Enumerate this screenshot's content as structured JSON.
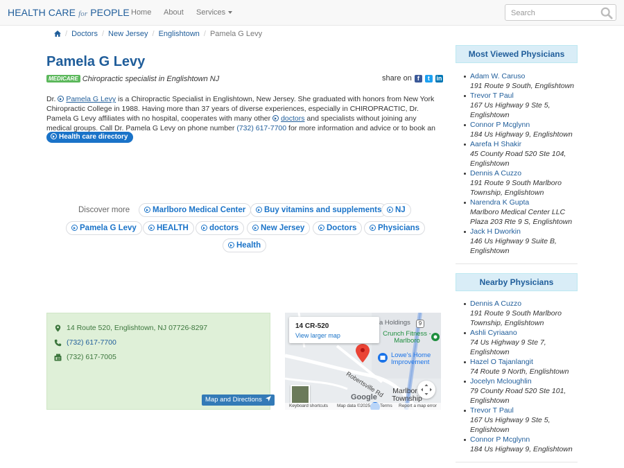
{
  "brand": {
    "health": "HEALTH CARE",
    "for": "for",
    "people": "PEOPLE"
  },
  "nav": {
    "home": "Home",
    "about": "About",
    "services": "Services"
  },
  "search": {
    "placeholder": "Search"
  },
  "breadcrumb": {
    "items": [
      "Doctors",
      "New Jersey",
      "Englishtown",
      "Pamela G Levy"
    ]
  },
  "profile": {
    "name": "Pamela G Levy",
    "badge": "MEDICARE",
    "specialty": "Chiropractic specialist in Englishtown NJ",
    "share_label": "share on"
  },
  "bio": {
    "t1": "Dr. ",
    "name_link": "Pamela G Levy",
    "t2": " is a Chiropractic Specialist in Englishtown, New Jersey. She graduated with honors from New York Chiropractic College in 1988. Having more than 37 years of diverse experiences, especially in CHIROPRACTIC, Dr. Pamela G Levy affiliates with no hospital, cooperates with many other ",
    "doctors_link": "doctors",
    "t3": " and specialists without joining any medical groups. Call Dr. Pamela G Levy on phone number ",
    "phone_link": "(732) 617-7700",
    "t4": " for more information and advice or to book an appointment.",
    "directory_button": "Health care directory"
  },
  "discover": {
    "label": "Discover more",
    "chips": [
      "Marlboro Medical Center",
      "Buy vitamins and supplements",
      "NJ",
      "Pamela G Levy",
      "HEALTH",
      "doctors",
      "New Jersey",
      "Doctors",
      "Physicians",
      "Health"
    ]
  },
  "contact": {
    "address": "14 Route 520, Englishtown, NJ 07726-8297",
    "phone": "(732) 617-7700",
    "fax": "(732) 617-7005",
    "map_button": "Map and Directions"
  },
  "map": {
    "card_title": "14 CR-520",
    "card_link": "View larger map",
    "labels": [
      "a Holdings",
      "Crunch Fitness - Marlboro",
      "Lowe's Home Improvement",
      "Robertsville Rd",
      "Marlboro Township"
    ],
    "route_shield": "9",
    "google": "Google",
    "footer": [
      "Keyboard shortcuts",
      "Map data ©2025",
      "Terms",
      "Report a map error"
    ]
  },
  "most_viewed": {
    "title": "Most Viewed Physicians",
    "items": [
      {
        "name": "Adam W. Caruso",
        "addr": "191 Route 9 South, Englishtown"
      },
      {
        "name": "Trevor T Paul",
        "addr": "167 Us Highway 9 Ste 5, Englishtown"
      },
      {
        "name": "Connor P Mcglynn",
        "addr": "184 Us Highway 9, Englishtown"
      },
      {
        "name": "Aarefa H Shakir",
        "addr": "45 County Road 520 Ste 104, Englishtown"
      },
      {
        "name": "Dennis A Cuzzo",
        "addr": "191 Route 9 South Marlboro Township, Englishtown"
      },
      {
        "name": "Narendra K Gupta",
        "addr": "Marlboro Medical Center LLC Plaza 203 Rte 9 S, Englishtown"
      },
      {
        "name": "Jack H Dworkin",
        "addr": "146 Us Highway 9 Suite B, Englishtown"
      }
    ]
  },
  "nearby": {
    "title": "Nearby Physicians",
    "items": [
      {
        "name": "Dennis A Cuzzo",
        "addr": "191 Route 9 South Marlboro Township, Englishtown"
      },
      {
        "name": "Ashli Cyriaano",
        "addr": "74 Us Highway 9 Ste 7, Englishtown"
      },
      {
        "name": "Hazel O Tajanlangit",
        "addr": "74 Route 9 North, Englishtown"
      },
      {
        "name": "Jocelyn Mcloughlin",
        "addr": "79 County Road 520 Ste 101, Englishtown"
      },
      {
        "name": "Trevor T Paul",
        "addr": "167 Us Highway 9 Ste 5, Englishtown"
      },
      {
        "name": "Connor P Mcglynn",
        "addr": "184 Us Highway 9, Englishtown"
      }
    ]
  }
}
